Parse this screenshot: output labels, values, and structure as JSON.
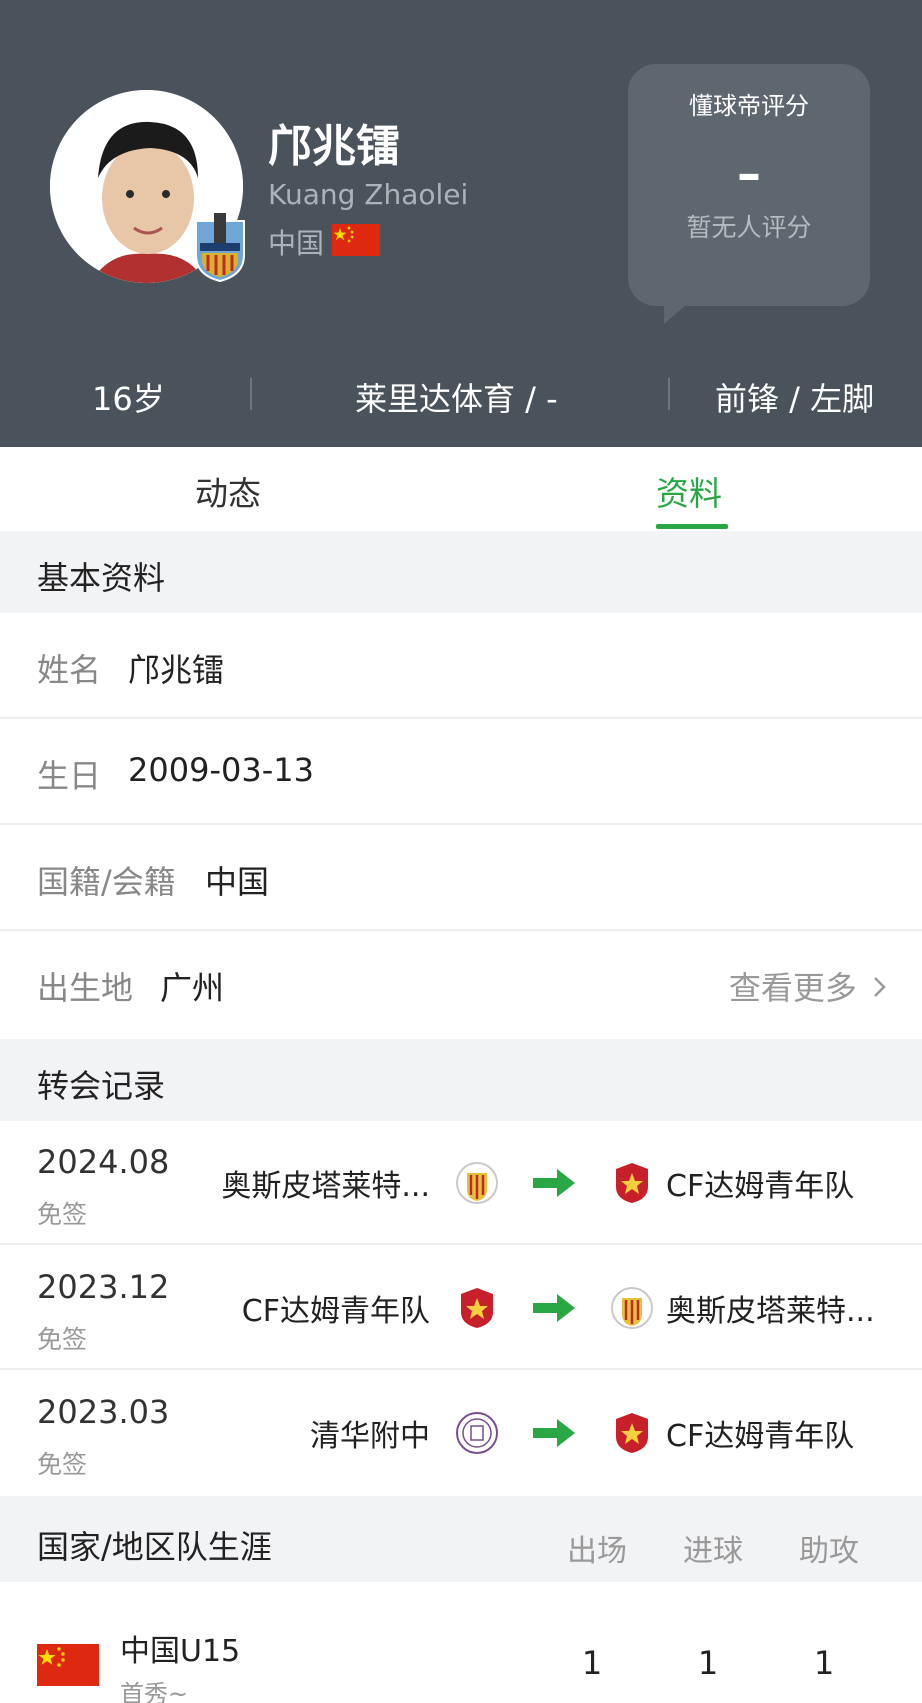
{
  "player": {
    "name_cn": "邝兆镭",
    "name_en": "Kuang Zhaolei",
    "nationality": "中国"
  },
  "rating": {
    "title": "懂球帝评分",
    "value": "–",
    "subtitle": "暂无人评分"
  },
  "info_strip": {
    "age": "16岁",
    "club": "莱里达体育 / -",
    "position": "前锋 / 左脚"
  },
  "tabs": [
    {
      "label": "动态",
      "active": false
    },
    {
      "label": "资料",
      "active": true
    }
  ],
  "basic_info": {
    "section_title": "基本资料",
    "rows": [
      {
        "label": "姓名",
        "value": "邝兆镭"
      },
      {
        "label": "生日",
        "value": "2009-03-13"
      },
      {
        "label": "国籍/会籍",
        "value": "中国"
      },
      {
        "label": "出生地",
        "value": "广州"
      }
    ],
    "more_link": "查看更多"
  },
  "transfers": {
    "section_title": "转会记录",
    "records": [
      {
        "date": "2024.08",
        "type": "免签",
        "from": "奥斯皮塔莱特...",
        "to": "CF达姆青年队"
      },
      {
        "date": "2023.12",
        "type": "免签",
        "from": "CF达姆青年队",
        "to": "奥斯皮塔莱特..."
      },
      {
        "date": "2023.03",
        "type": "免签",
        "from": "清华附中",
        "to": "CF达姆青年队"
      }
    ]
  },
  "national_career": {
    "section_title": "国家/地区队生涯",
    "columns": [
      "出场",
      "进球",
      "助攻"
    ],
    "teams": [
      {
        "name": "中国U15",
        "note": "首秀~",
        "appearances": "1",
        "goals": "1",
        "assists": "1"
      }
    ]
  },
  "colors": {
    "header_bg": "#4a535c",
    "accent_green": "#2aa745",
    "flag_red": "#de2910",
    "flag_yellow": "#ffde00"
  }
}
